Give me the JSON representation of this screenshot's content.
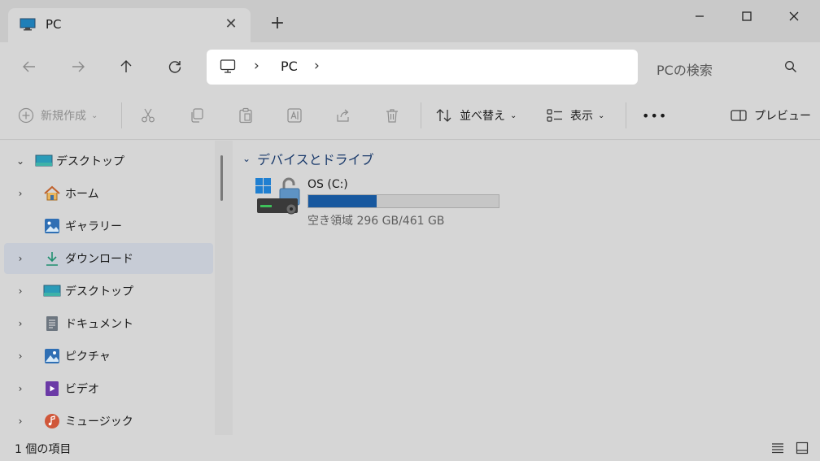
{
  "window": {
    "tab": {
      "title": "PC",
      "icon": "monitor-icon"
    },
    "controls": [
      "minimize-icon",
      "maximize-icon",
      "close-icon"
    ]
  },
  "navigation": {
    "icons": [
      "back-arrow-icon",
      "forward-arrow-icon",
      "up-arrow-icon",
      "refresh-icon"
    ],
    "address": {
      "icon": "monitor-icon",
      "crumbs": [
        "PC"
      ]
    },
    "search": {
      "placeholder": "PCの検索",
      "icon": "search-icon"
    }
  },
  "toolbar": {
    "new_label": "新規作成",
    "sort_label": "並べ替え",
    "view_label": "表示",
    "preview_label": "プレビュー",
    "more_label": "•••"
  },
  "sidebar": {
    "items": [
      {
        "label": "デスクトップ",
        "icon": "desktop-icon",
        "expanded": true,
        "selected": false
      },
      {
        "label": "ホーム",
        "icon": "home-icon",
        "expanded": false,
        "selected": false
      },
      {
        "label": "ギャラリー",
        "icon": "gallery-icon",
        "expanded": null,
        "selected": false
      },
      {
        "label": "ダウンロード",
        "icon": "download-icon",
        "expanded": false,
        "selected": true
      },
      {
        "label": "デスクトップ",
        "icon": "desktop-icon",
        "expanded": false,
        "selected": false
      },
      {
        "label": "ドキュメント",
        "icon": "document-icon",
        "expanded": false,
        "selected": false
      },
      {
        "label": "ピクチャ",
        "icon": "pictures-icon",
        "expanded": false,
        "selected": false
      },
      {
        "label": "ビデオ",
        "icon": "video-icon",
        "expanded": false,
        "selected": false
      },
      {
        "label": "ミュージック",
        "icon": "music-icon",
        "expanded": false,
        "selected": false
      }
    ]
  },
  "content": {
    "group_label": "デバイスとドライブ",
    "drives": [
      {
        "name": "OS (C:)",
        "free_text": "空き領域 296 GB/461 GB",
        "used_fraction": 0.358,
        "icon": "drive-locked-icon"
      }
    ]
  },
  "status": {
    "item_count": "1 個の項目"
  },
  "colors": {
    "accent": "#17589f",
    "group_text": "#1a3a6b",
    "selected_bg": "#c7ccd6"
  }
}
